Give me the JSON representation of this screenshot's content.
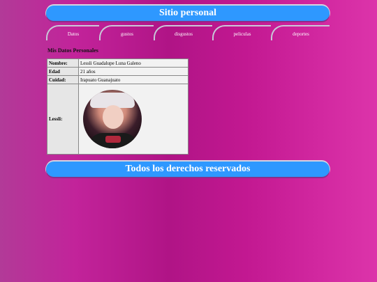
{
  "header": {
    "title": "Sitio personal"
  },
  "nav": {
    "tabs": [
      "Datos",
      "gustos",
      "disgustos",
      "peliculas",
      "deportes"
    ]
  },
  "section": {
    "title": "Mis Datos Personales"
  },
  "table": {
    "rows": [
      {
        "key": "Nombre:",
        "value": "Lessli Guadalupe Luna Galeno"
      },
      {
        "key": "Edad",
        "value": "21 años"
      },
      {
        "key": "Cuidad:",
        "value": "Irapuato Guanajuato"
      }
    ],
    "photo_row": {
      "key": "Lessli:"
    }
  },
  "footer": {
    "text": "Todos los derechos reservados"
  }
}
